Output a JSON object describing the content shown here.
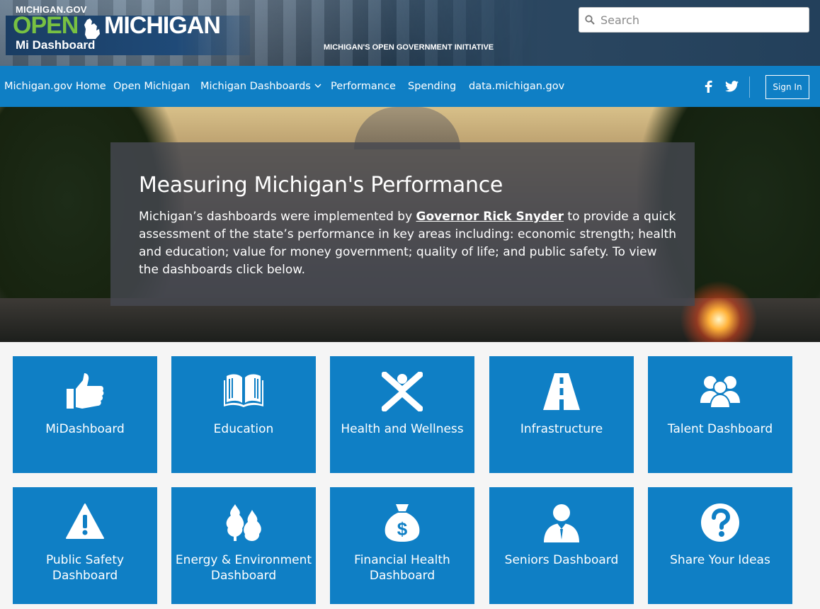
{
  "header": {
    "logo_gov": "MICHIGAN.GOV",
    "logo_open": "OPEN",
    "logo_michigan": "MICHIGAN",
    "logo_sub": "Mi Dashboard",
    "tagline": "MICHIGAN'S OPEN GOVERNMENT INITIATIVE",
    "search_placeholder": "Search"
  },
  "nav": {
    "items": [
      "Michigan.gov Home",
      "Open Michigan",
      "Michigan Dashboards",
      "Performance",
      "Spending",
      "data.michigan.gov"
    ],
    "signin": "Sign In"
  },
  "hero": {
    "title": "Measuring Michigan's Performance",
    "text_before": "Michigan’s dashboards were implemented by ",
    "link": "Governor Rick Snyder",
    "text_after": " to provide a quick assessment of the state’s performance in key areas including: economic strength; health and education; value for money government; quality of life; and public safety. To view the dashboards click below."
  },
  "tiles": [
    {
      "label": "MiDashboard",
      "icon": "thumbs-up-icon"
    },
    {
      "label": "Education",
      "icon": "open-book-icon"
    },
    {
      "label": "Health and Wellness",
      "icon": "person-x-icon"
    },
    {
      "label": "Infrastructure",
      "icon": "road-icon"
    },
    {
      "label": "Talent Dashboard",
      "icon": "people-group-icon"
    },
    {
      "label": "Public Safety Dashboard",
      "icon": "warning-icon"
    },
    {
      "label": "Energy & Environment Dashboard",
      "icon": "trees-icon"
    },
    {
      "label": "Financial Health Dashboard",
      "icon": "money-bag-icon"
    },
    {
      "label": "Seniors Dashboard",
      "icon": "person-suit-icon"
    },
    {
      "label": "Share Your Ideas",
      "icon": "question-icon"
    }
  ],
  "colors": {
    "brand_blue": "#0f7fc5",
    "logo_green": "#78c142",
    "header_dark": "#23405b"
  }
}
